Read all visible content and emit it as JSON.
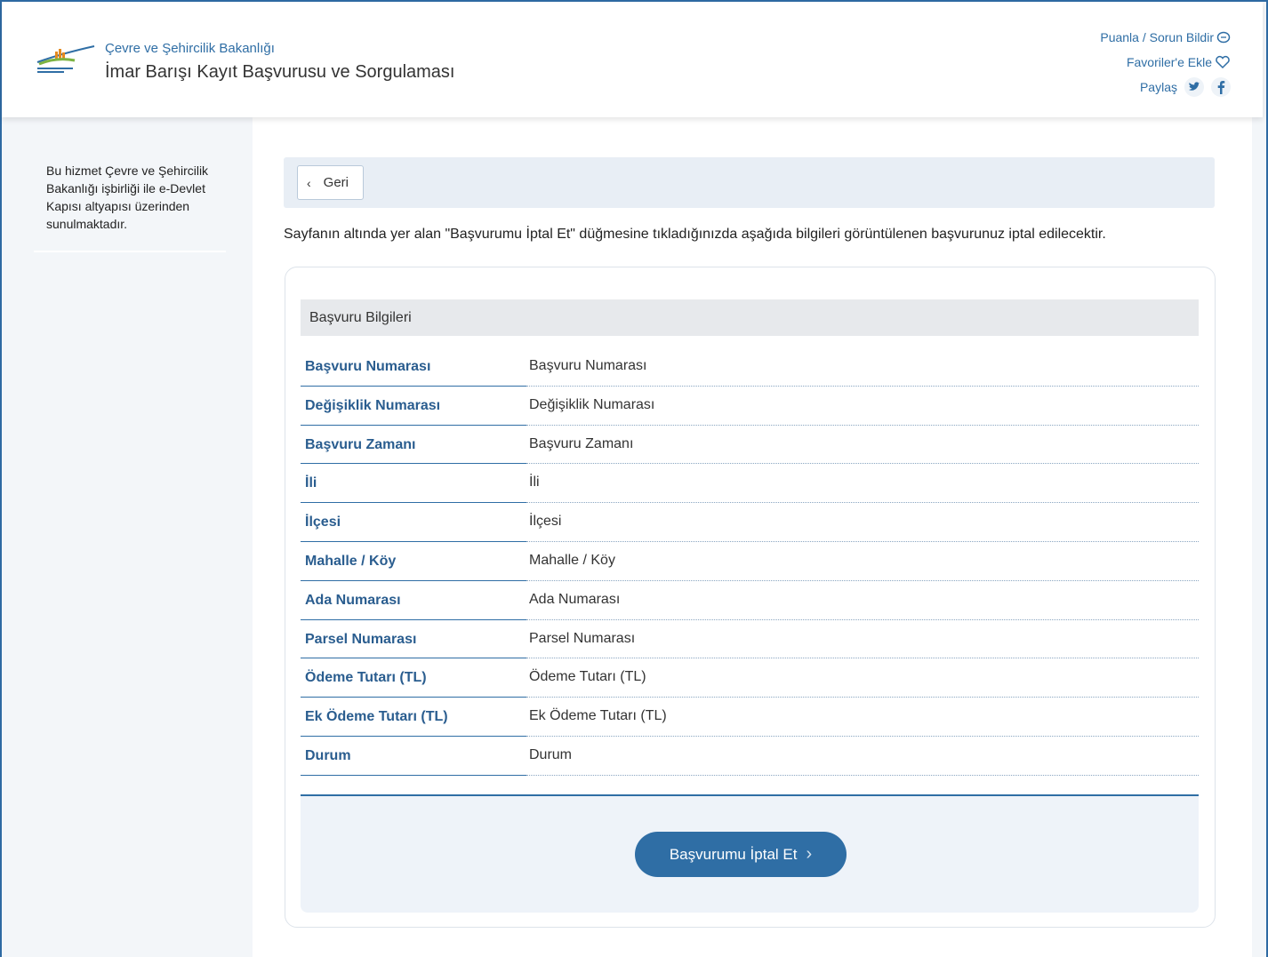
{
  "header": {
    "ministry": "Çevre ve Şehircilik Bakanlığı",
    "service_title": "İmar Barışı Kayıt Başvurusu ve Sorgulaması",
    "links": {
      "rate": "Puanla / Sorun Bildir",
      "favorite": "Favoriler'e Ekle",
      "share": "Paylaş"
    }
  },
  "sidebar": {
    "info": "Bu hizmet Çevre ve Şehircilik Bakanlığı işbirliği ile e-Devlet Kapısı altyapısı üzerinden sunulmaktadır."
  },
  "main": {
    "back_label": "Geri",
    "notice": "Sayfanın altında yer alan \"Başvurumu İptal Et\" düğmesine tıkladığınızda aşağıda bilgileri görüntülenen başvurunuz iptal edilecektir.",
    "section_title": "Başvuru Bilgileri",
    "rows": [
      {
        "label": "Başvuru Numarası",
        "value": "Başvuru Numarası"
      },
      {
        "label": "Değişiklik Numarası",
        "value": "Değişiklik Numarası"
      },
      {
        "label": "Başvuru Zamanı",
        "value": "Başvuru Zamanı"
      },
      {
        "label": "İli",
        "value": "İli"
      },
      {
        "label": "İlçesi",
        "value": "İlçesi"
      },
      {
        "label": "Mahalle / Köy",
        "value": "Mahalle / Köy"
      },
      {
        "label": "Ada Numarası",
        "value": "Ada Numarası"
      },
      {
        "label": "Parsel Numarası",
        "value": "Parsel Numarası"
      },
      {
        "label": "Ödeme Tutarı (TL)",
        "value": "Ödeme Tutarı (TL)"
      },
      {
        "label": "Ek Ödeme Tutarı (TL)",
        "value": "Ek Ödeme Tutarı (TL)"
      },
      {
        "label": "Durum",
        "value": "Durum"
      }
    ],
    "cancel_label": "Başvurumu İptal Et"
  },
  "colors": {
    "accent": "#2f6ea5",
    "label": "#2a5d8f"
  }
}
